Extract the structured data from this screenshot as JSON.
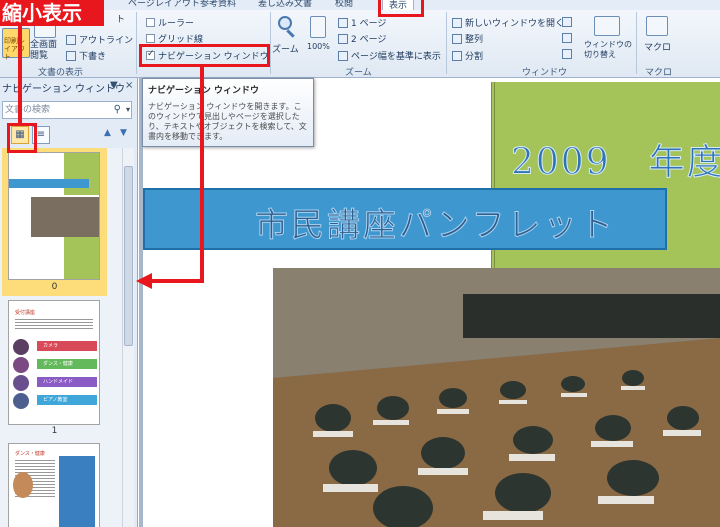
{
  "ribbon": {
    "tabs": [
      "ページレイアウト",
      "参考資料",
      "差し込み文書",
      "校閲",
      "表示"
    ],
    "active_tab": "表示",
    "doc_views": {
      "partial": "ト",
      "fullscreen": "全画面閲覧",
      "outline": "アウトライン",
      "draft": "下書き",
      "print": "印刷レイアウト",
      "group_label": "文書の表示"
    },
    "show": {
      "ruler": "ルーラー",
      "grid": "グリッド線",
      "navpane": "ナビゲーション ウィンドウ"
    },
    "zoom": {
      "zoom": "ズーム",
      "percent": "100%",
      "one_page": "1 ページ",
      "two_pages": "2 ページ",
      "page_width": "ページ幅を基準に表示",
      "group_label": "ズーム"
    },
    "window": {
      "new_window": "新しいウィンドウを開く",
      "arrange": "整列",
      "split": "分割",
      "switch": "ウィンドウの切り替え",
      "group_label": "ウィンドウ"
    },
    "macro": {
      "macro": "マクロ",
      "group_label": "マクロ"
    }
  },
  "annotation": {
    "label": "縮小表示"
  },
  "nav_pane": {
    "title": "ナビゲーション ウィンドウ",
    "search_placeholder": "文書の検索",
    "pages": [
      "0",
      "1"
    ]
  },
  "thumb_texts": {
    "p1_title": "受付講座",
    "p1_items": [
      "カメラ",
      "ダンス・健康",
      "ハンドメイド",
      "ピアノ教室"
    ],
    "p2_title": "ダンス・健康"
  },
  "tooltip": {
    "title": "ナビゲーション ウィンドウ",
    "body": "ナビゲーション ウィンドウを開きます。このウィンドウで見出しやページを選択したり、テキストやオブジェクトを検索して、文書内を移動できます。"
  },
  "document": {
    "year": "2009　年度",
    "title": "市民講座パンフレット"
  },
  "colors": {
    "annotation_red": "#e8161d",
    "title_band": "#3f97cf",
    "cover_green": "#a4c45a"
  }
}
